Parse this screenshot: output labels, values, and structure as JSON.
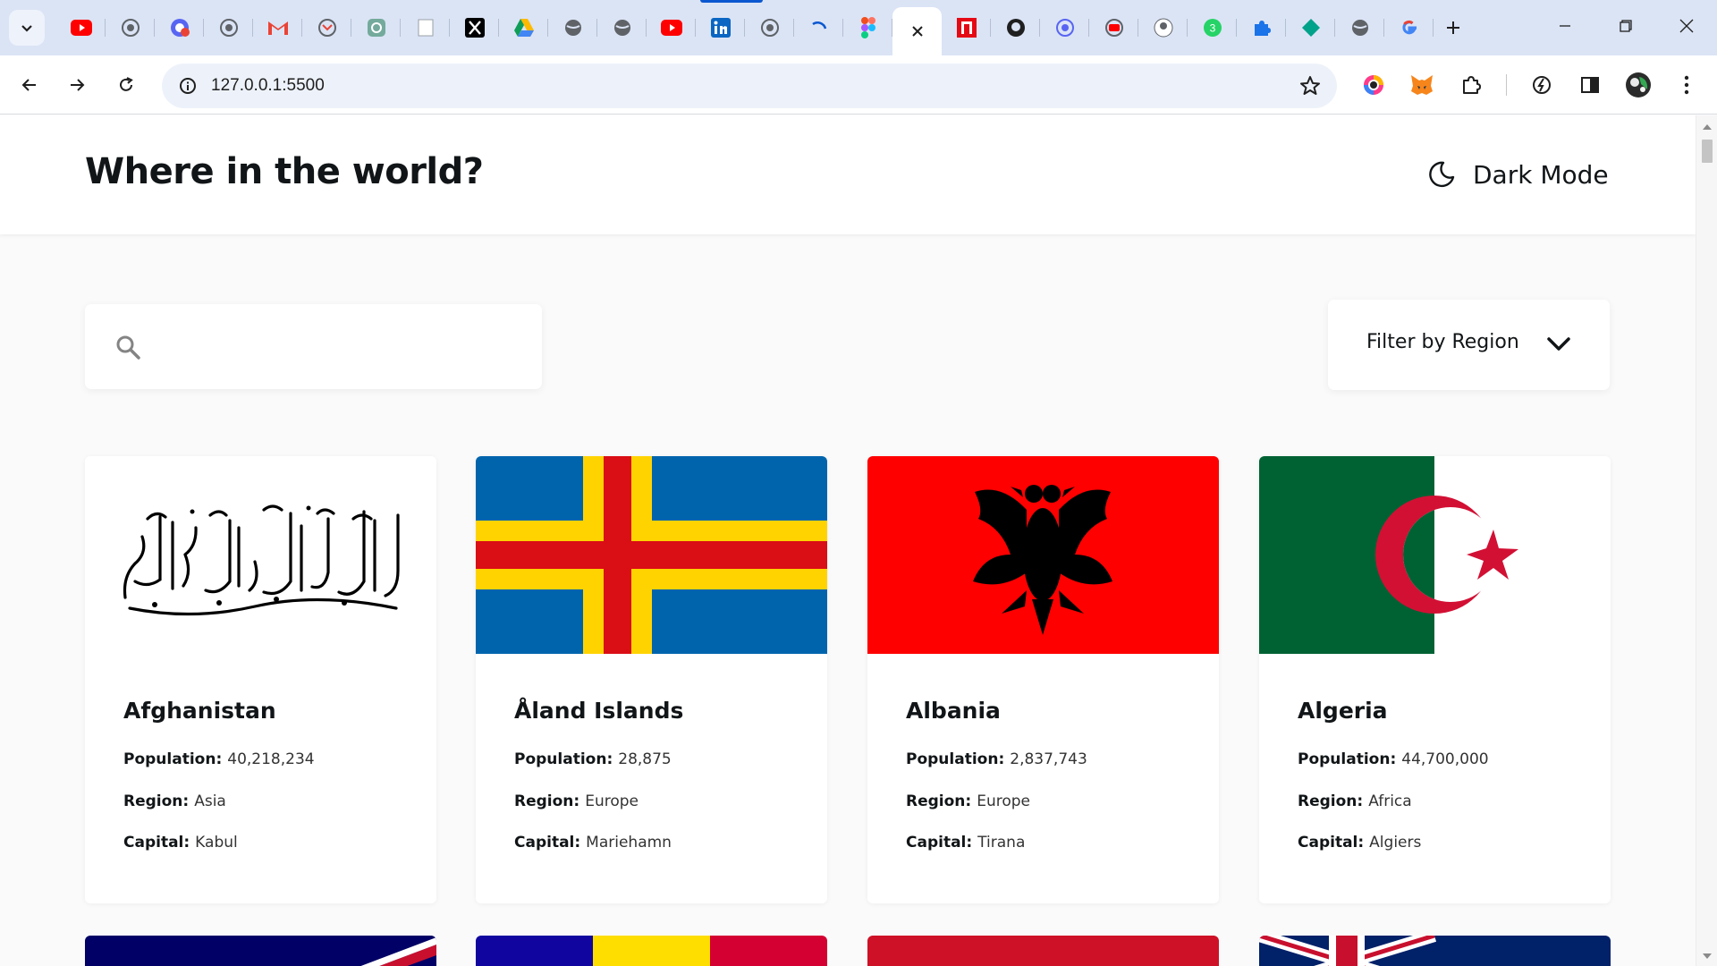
{
  "browser": {
    "url": "127.0.0.1:5500",
    "tab_count_badge": "3",
    "accent": "#0b57d0"
  },
  "app": {
    "title": "Where in the world?",
    "dark_mode_label": "Dark Mode"
  },
  "search": {
    "placeholder": ""
  },
  "filter": {
    "label": "Filter by Region"
  },
  "labels": {
    "population": "Population:",
    "region": "Region:",
    "capital": "Capital:"
  },
  "countries": [
    {
      "name": "Afghanistan",
      "population": "40,218,234",
      "region": "Asia",
      "capital": "Kabul",
      "flag": "afghanistan-flag"
    },
    {
      "name": "Åland Islands",
      "population": "28,875",
      "region": "Europe",
      "capital": "Mariehamn",
      "flag": "aland-flag",
      "colors": [
        "#0064ad",
        "#ffd300",
        "#da0e15"
      ]
    },
    {
      "name": "Albania",
      "population": "2,837,743",
      "region": "Europe",
      "capital": "Tirana",
      "flag": "albania-flag",
      "colors": [
        "#ff0000",
        "#000000"
      ]
    },
    {
      "name": "Algeria",
      "population": "44,700,000",
      "region": "Africa",
      "capital": "Algiers",
      "flag": "algeria-flag",
      "colors": [
        "#006233",
        "#ffffff",
        "#d21034"
      ]
    }
  ]
}
